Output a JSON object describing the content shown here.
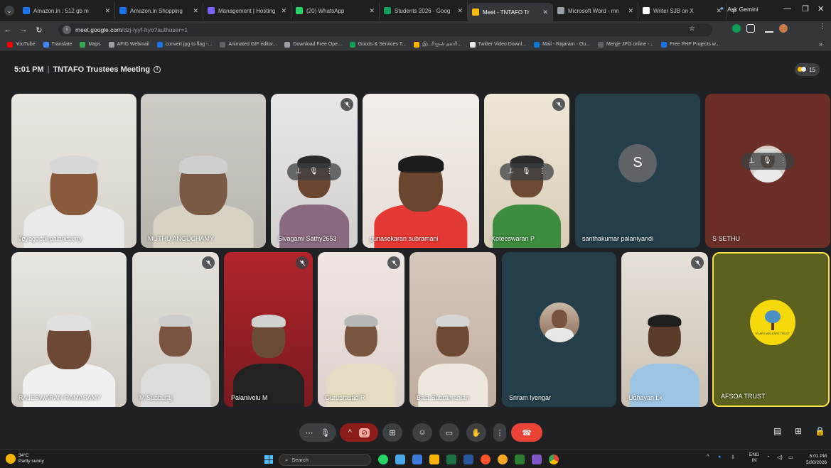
{
  "browser": {
    "tabs": [
      {
        "title": "Amazon.in : 512 gb m",
        "color": "#1a73e8"
      },
      {
        "title": "Amazon.in Shopping",
        "color": "#1a73e8"
      },
      {
        "title": "Management | Hosting",
        "color": "#7b61ff"
      },
      {
        "title": "(20) WhatsApp",
        "color": "#25d366"
      },
      {
        "title": "Students 2026 - Goog",
        "color": "#0f9d58"
      },
      {
        "title": "Meet - TNTAFO Tr",
        "color": "#fbbc04",
        "active": true
      },
      {
        "title": "Microsoft Word - mn",
        "color": "#9aa0a6"
      },
      {
        "title": "Writer SJB on X",
        "color": "#ffffff"
      }
    ],
    "new_tab": "+",
    "gemini": "Ask Gemini",
    "url_host": "meet.google.com",
    "url_path": "/dzj-iyyf-hyo?authuser=1",
    "bookmarks": [
      "YouTube",
      "Translate",
      "Maps",
      "AFIG Webmail",
      "convert jpg to flag -...",
      "Animated GIF editor...",
      "Download Free Ope...",
      "Goods & Services T...",
      "இடரிஞன் தளரி...",
      "Twitter Video Downl...",
      "Mail - Rajaram - Ou...",
      "Merge JPG online -...",
      "Free PHP Projects w..."
    ],
    "bookmarks_more": "»"
  },
  "meet": {
    "time": "5:01 PM",
    "separator": "|",
    "title": "TNTAFO Trustees Meeting",
    "people_count": "15",
    "avatar_letter": "S",
    "participants_row1": [
      "Jeyagopal palanisamy",
      "MUTHU ANGUCHAMY",
      "Sivagami Sathy2653",
      "gunasekaran subramani",
      "Koteeswaran P",
      "santhakumar palaniyandi",
      "S SETHU"
    ],
    "participants_row2": [
      "RAJESWARAN RAMASAMY",
      "M Subburaj",
      "Palanivelu M",
      "Guruprasad R",
      "Bala Subramanian",
      "Sriram Iyengar",
      "Udhayan t.k",
      "AFSOA TRUST"
    ],
    "logo_text": "TN AFO WELFARE TRUST"
  },
  "taskbar": {
    "temperature": "34°C",
    "weather": "Partly sunny",
    "search": "Search",
    "lang1": "ENG",
    "lang2": "IN",
    "clock_time": "5:01 PM",
    "clock_date": "5/30/2026"
  }
}
